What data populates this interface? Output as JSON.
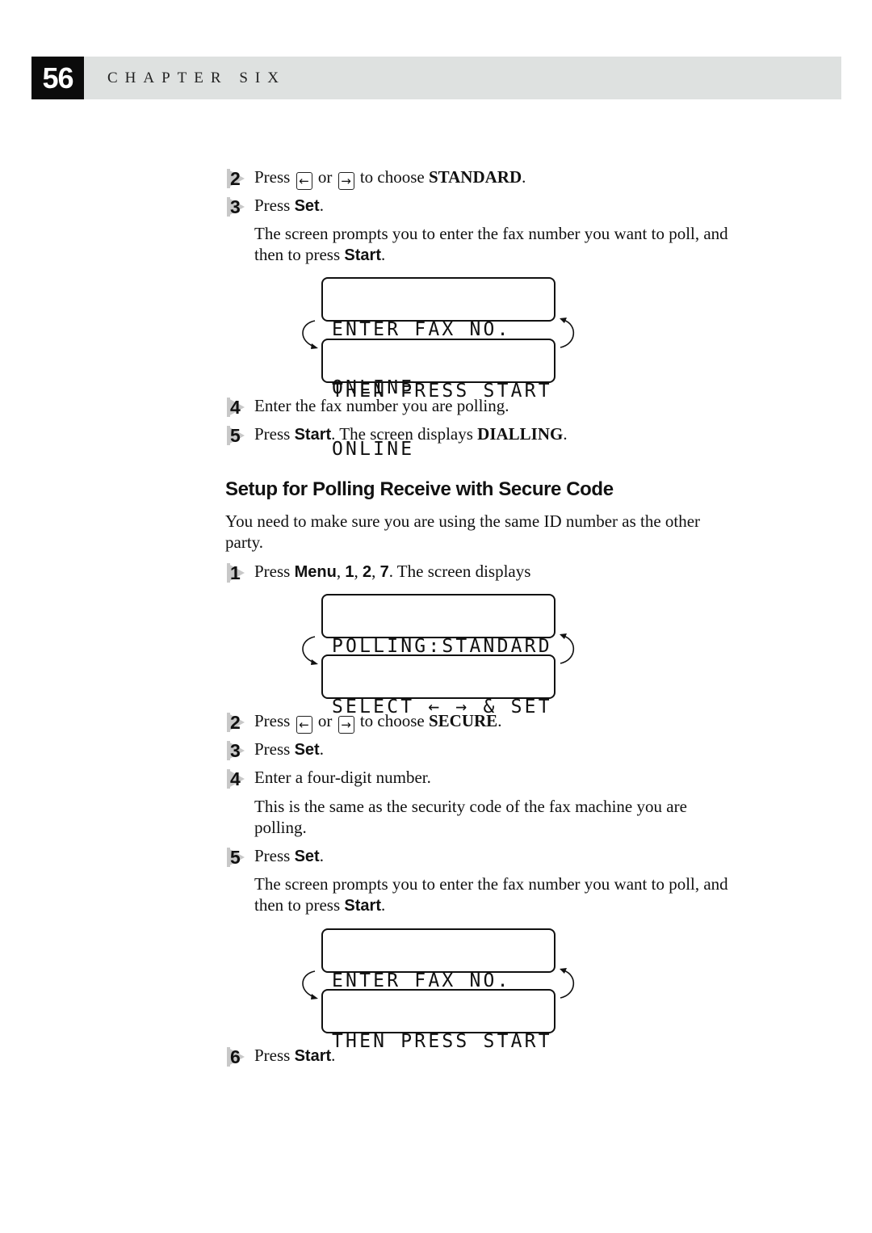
{
  "header": {
    "page_number": "56",
    "chapter_label": "CHAPTER SIX"
  },
  "section1": {
    "step2": {
      "num": "2",
      "pre": "Press",
      "or": "or",
      "post": "to choose",
      "target": "STANDARD",
      "end": "."
    },
    "step3": {
      "num": "3",
      "pre": "Press",
      "key": "Set",
      "end": "."
    },
    "prompt": {
      "text": "The screen prompts you to enter the fax number you want to poll, and then to press",
      "key": "Start",
      "end": "."
    },
    "lcd1": {
      "line1": "ENTER FAX NO.",
      "line2": "ONLINE"
    },
    "lcd2": {
      "line1": "THEN PRESS START",
      "line2": "ONLINE"
    },
    "step4": {
      "num": "4",
      "text": "Enter the fax number you are polling."
    },
    "step5": {
      "num": "5",
      "pre": "Press",
      "key": "Start",
      "mid": ". The screen displays",
      "target": "DIALLING",
      "end": "."
    }
  },
  "section2": {
    "heading": "Setup for Polling Receive with Secure Code",
    "intro": "You need to make sure you are using the same ID number as the other party.",
    "step1": {
      "num": "1",
      "pre": "Press",
      "k1": "Menu",
      "c1": ",",
      "k2": "1",
      "c2": ",",
      "k3": "2",
      "c3": ",",
      "k4": "7",
      "post": ". The screen displays"
    },
    "lcd1": {
      "line1": "POLLING:STANDARD",
      "line2": ""
    },
    "lcd2": {
      "line1": "SELECT ← → & SET",
      "line2": ""
    },
    "step2": {
      "num": "2",
      "pre": "Press",
      "or": "or",
      "post": "to choose",
      "target": "SECURE",
      "end": "."
    },
    "step3": {
      "num": "3",
      "pre": "Press",
      "key": "Set",
      "end": "."
    },
    "step4": {
      "num": "4",
      "text": "Enter a four-digit number."
    },
    "step4_note": "This is the same as the security code of the fax machine you are polling.",
    "step5": {
      "num": "5",
      "pre": "Press",
      "key": "Set",
      "end": "."
    },
    "prompt": {
      "text": "The screen prompts you to enter the fax number you want to poll, and then to press",
      "key": "Start",
      "end": "."
    },
    "lcd3": {
      "line1": "ENTER FAX NO.",
      "line2": ""
    },
    "lcd4": {
      "line1": "THEN PRESS START",
      "line2": ""
    },
    "step6": {
      "num": "6",
      "pre": "Press",
      "key": "Start",
      "end": "."
    }
  },
  "icons": {
    "left_key": "←",
    "right_key": "→"
  }
}
